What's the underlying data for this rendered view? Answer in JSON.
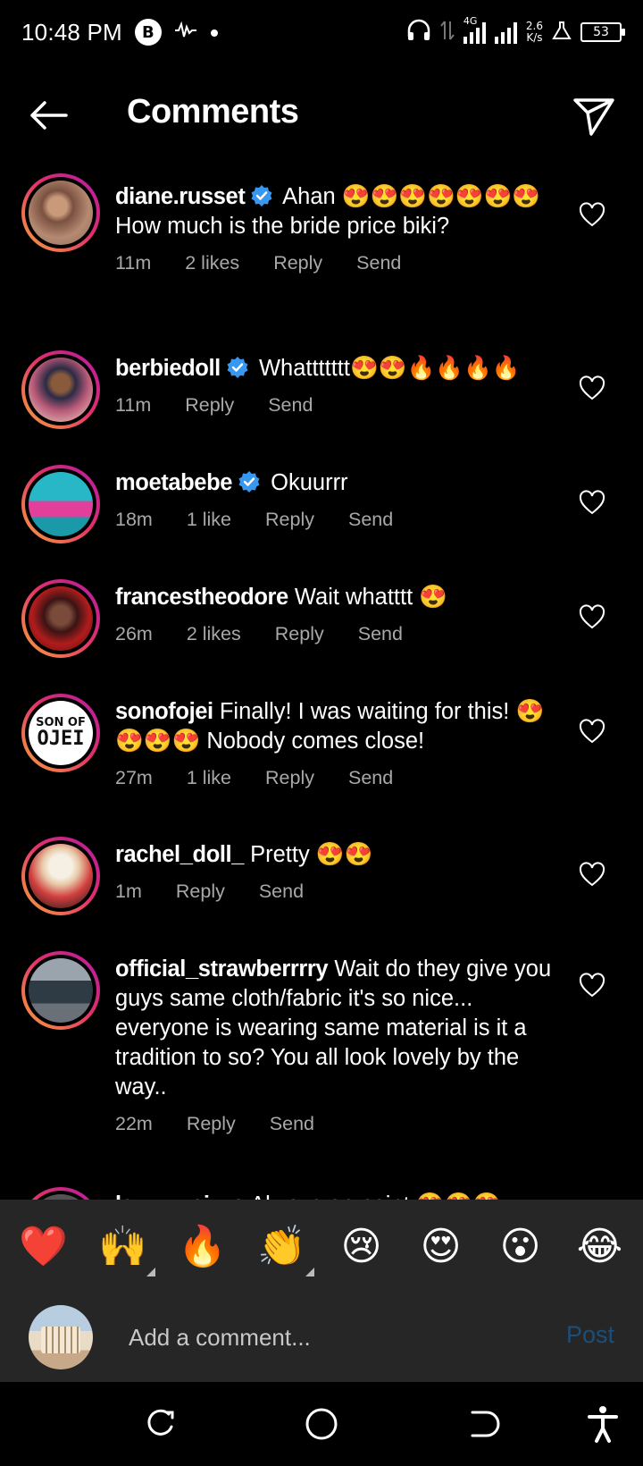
{
  "status_bar": {
    "time": "10:48 PM",
    "badge": "B",
    "signal": "4G",
    "net_speed_value": "2.6",
    "net_speed_unit": "K/s",
    "battery": "53"
  },
  "header": {
    "title": "Comments",
    "back_icon": "arrow-left-icon",
    "share_icon": "paper-plane-icon"
  },
  "comments": [
    {
      "username": "diane.russet",
      "verified": true,
      "text": "Ahan 😍😍😍😍😍😍😍\nHow much is the bride price biki?",
      "time": "11m",
      "likes": "2 likes",
      "reply": "Reply",
      "send": "Send"
    },
    {
      "username": "berbiedoll",
      "verified": true,
      "text": "Whattttttt😍😍🔥🔥🔥🔥",
      "time": "11m",
      "likes": "",
      "reply": "Reply",
      "send": "Send"
    },
    {
      "username": "moetabebe",
      "verified": true,
      "text": "Okuurrr",
      "time": "18m",
      "likes": "1 like",
      "reply": "Reply",
      "send": "Send"
    },
    {
      "username": "francestheodore",
      "verified": false,
      "text": "Wait whatttt 😍",
      "time": "26m",
      "likes": "2 likes",
      "reply": "Reply",
      "send": "Send"
    },
    {
      "username": "sonofojei",
      "verified": false,
      "text": "Finally! I was waiting for this! 😍😍😍😍 Nobody comes close!",
      "time": "27m",
      "likes": "1 like",
      "reply": "Reply",
      "send": "Send",
      "avatar_text_1": "SON OF",
      "avatar_text_2": "OJEI"
    },
    {
      "username": "rachel_doll_",
      "verified": false,
      "text": "Pretty 😍😍",
      "time": "1m",
      "likes": "",
      "reply": "Reply",
      "send": "Send"
    },
    {
      "username": "official_strawberrrry",
      "verified": false,
      "text": "Wait do they give you guys same cloth/fabric it's so nice... everyone is wearing same material is it a tradition to so? You all look lovely by the way..",
      "time": "22m",
      "likes": "",
      "reply": "Reply",
      "send": "Send"
    },
    {
      "username": "lazzzy_sizzo",
      "verified": false,
      "text": "Always on point 😍😍😍",
      "time": "",
      "likes": "",
      "reply": "",
      "send": ""
    }
  ],
  "reactions": [
    "❤️",
    "🙌",
    "🔥",
    "👏",
    "😢",
    "😍",
    "😮",
    "😂"
  ],
  "input_bar": {
    "placeholder": "Add a comment...",
    "post_label": "Post"
  },
  "colors": {
    "background": "#000000",
    "panel": "#262626",
    "verified": "#3897f0",
    "meta_text": "#a8a8a8",
    "post_disabled": "#1b4f7a"
  },
  "nav_icons": [
    "recents-icon",
    "home-icon",
    "back-icon",
    "accessibility-icon"
  ]
}
